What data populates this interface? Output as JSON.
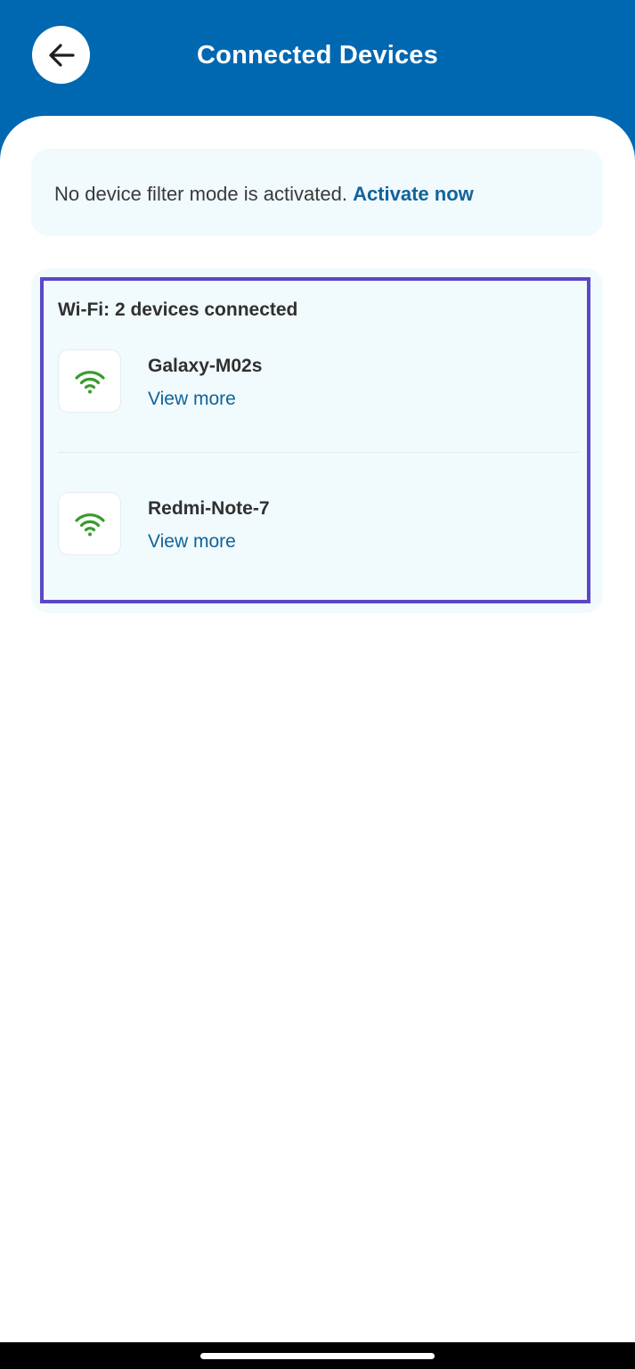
{
  "header": {
    "title": "Connected Devices",
    "back_icon": "arrow-left-icon"
  },
  "filter_banner": {
    "message": "No device filter mode is activated.",
    "link_label": "Activate now"
  },
  "wifi_section": {
    "title": "Wi-Fi: 2 devices connected",
    "devices": [
      {
        "name": "Galaxy-M02s",
        "link_label": "View more",
        "icon": "wifi-icon"
      },
      {
        "name": "Redmi-Note-7",
        "link_label": "View more",
        "icon": "wifi-icon"
      }
    ]
  },
  "colors": {
    "header_bg": "#0067b1",
    "card_bg": "#f1fafd",
    "link": "#11639a",
    "wifi_icon": "#3a9a2f",
    "highlight_border": "#5b47c7"
  }
}
